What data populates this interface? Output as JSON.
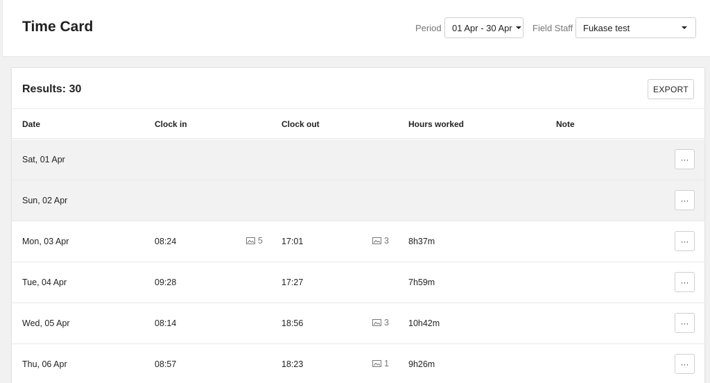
{
  "header": {
    "title": "Time Card",
    "period_label": "Period",
    "period_value": "01 Apr - 30 Apr",
    "staff_label": "Field Staff",
    "staff_value": "Fukase test"
  },
  "results": {
    "label": "Results: 30",
    "export_label": "EXPORT"
  },
  "table": {
    "columns": [
      "Date",
      "Clock in",
      "Clock out",
      "Hours worked",
      "Note"
    ],
    "rows": [
      {
        "date": "Sat, 01 Apr",
        "clock_in": "",
        "in_photos": "",
        "clock_out": "",
        "out_photos": "",
        "hours": "",
        "note": "",
        "weekend": true
      },
      {
        "date": "Sun, 02 Apr",
        "clock_in": "",
        "in_photos": "",
        "clock_out": "",
        "out_photos": "",
        "hours": "",
        "note": "",
        "weekend": true
      },
      {
        "date": "Mon, 03 Apr",
        "clock_in": "08:24",
        "in_photos": "5",
        "clock_out": "17:01",
        "out_photos": "3",
        "hours": "8h37m",
        "note": "",
        "weekend": false
      },
      {
        "date": "Tue, 04 Apr",
        "clock_in": "09:28",
        "in_photos": "",
        "clock_out": "17:27",
        "out_photos": "",
        "hours": "7h59m",
        "note": "",
        "weekend": false
      },
      {
        "date": "Wed, 05 Apr",
        "clock_in": "08:14",
        "in_photos": "",
        "clock_out": "18:56",
        "out_photos": "3",
        "hours": "10h42m",
        "note": "",
        "weekend": false
      },
      {
        "date": "Thu, 06 Apr",
        "clock_in": "08:57",
        "in_photos": "",
        "clock_out": "18:23",
        "out_photos": "1",
        "hours": "9h26m",
        "note": "",
        "weekend": false
      }
    ],
    "more_label": "···"
  },
  "icons": {
    "photo": "image-icon",
    "more": "ellipsis-icon",
    "caret": "caret-down-icon"
  }
}
